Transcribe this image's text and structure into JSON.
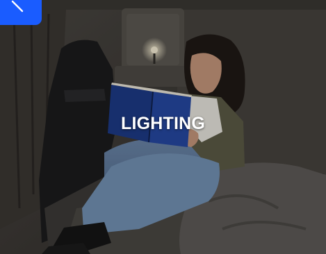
{
  "card": {
    "title": "LIGHTING",
    "badge_icon": "chevron-left-icon",
    "badge_color": "#1a5cff"
  }
}
